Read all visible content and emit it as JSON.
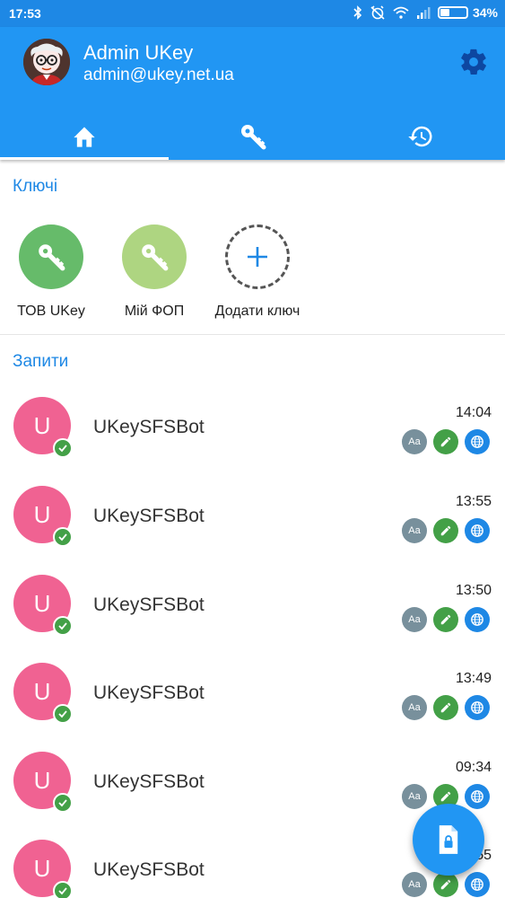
{
  "status_bar": {
    "time": "17:53",
    "battery": "34%",
    "battery_level": 0.34
  },
  "header": {
    "user_name": "Admin UKey",
    "user_email": "admin@ukey.net.ua",
    "tabs": [
      {
        "icon": "home-icon",
        "selected": true
      },
      {
        "icon": "key-icon",
        "selected": false
      },
      {
        "icon": "history-icon",
        "selected": false
      }
    ]
  },
  "keys": {
    "title": "Ключі",
    "items": [
      {
        "label": "ТОВ UKey",
        "color": "#66bb6a"
      },
      {
        "label": "Мій ФОП",
        "color": "#aed581"
      }
    ],
    "add_label": "Додати ключ"
  },
  "requests": {
    "title": "Запити",
    "items": [
      {
        "initial": "U",
        "name": "UKeySFSBot",
        "time": "14:04"
      },
      {
        "initial": "U",
        "name": "UKeySFSBot",
        "time": "13:55"
      },
      {
        "initial": "U",
        "name": "UKeySFSBot",
        "time": "13:50"
      },
      {
        "initial": "U",
        "name": "UKeySFSBot",
        "time": "13:49"
      },
      {
        "initial": "U",
        "name": "UKeySFSBot",
        "time": "09:34"
      },
      {
        "initial": "U",
        "name": "UKeySFSBot",
        "time": "…55"
      }
    ],
    "badge_text": "Aa"
  },
  "colors": {
    "primary": "#2196f3",
    "status_bar": "#1e88e5",
    "accent_text": "#1e88e5",
    "avatar": "#f06292"
  }
}
